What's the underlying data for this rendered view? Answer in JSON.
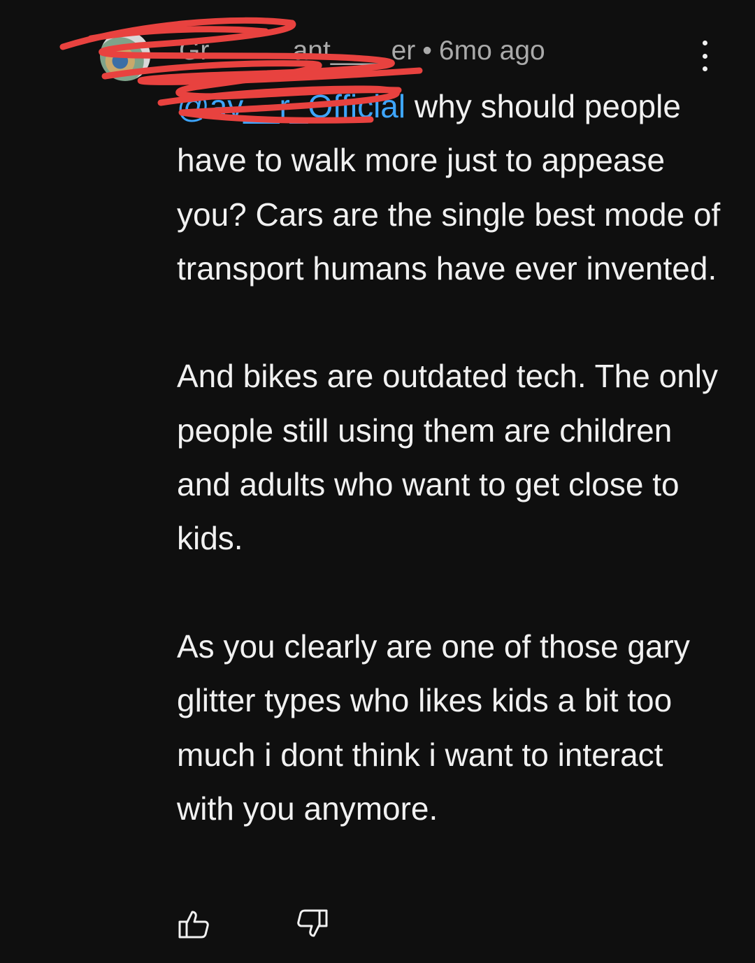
{
  "comment": {
    "author": "Gr__ ___ant____er",
    "time": "6mo ago",
    "mention": "@av__r_Official",
    "paragraphs": [
      " why should people have to walk more just to appease you?  Cars are the single best mode of transport humans have ever invented.",
      "And bikes are outdated tech. The only people still using them are children and adults who want to get close to kids.",
      "As you clearly are one of those gary glitter types who likes kids a bit too much i dont think i want to interact with you anymore."
    ]
  },
  "icons": {
    "more": "more-vert-icon",
    "like": "thumbs-up-icon",
    "dislike": "thumbs-down-icon"
  },
  "colors": {
    "background": "#0f0f0f",
    "text": "#f1f1f1",
    "secondary_text": "#aaaaaa",
    "mention": "#3ea6ff",
    "redaction": "#e8423f"
  }
}
